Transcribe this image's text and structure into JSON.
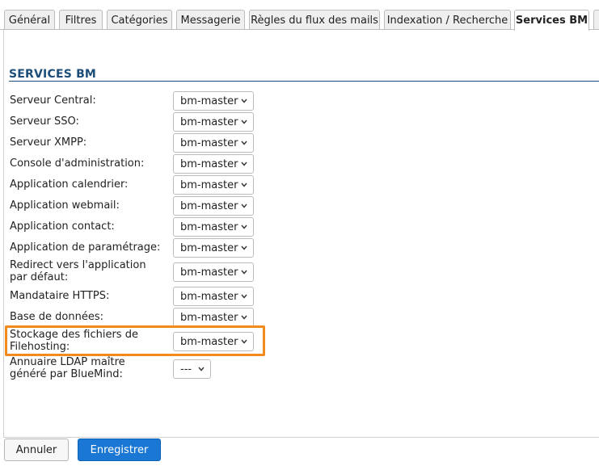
{
  "tabs": [
    {
      "label": "Général",
      "active": false
    },
    {
      "label": "Filtres",
      "active": false
    },
    {
      "label": "Catégories",
      "active": false
    },
    {
      "label": "Messagerie",
      "active": false
    },
    {
      "label": "Règles du flux des mails",
      "active": false
    },
    {
      "label": "Indexation / Recherche",
      "active": false
    },
    {
      "label": "Services BM",
      "active": true
    }
  ],
  "section": {
    "title": "SERVICES BM"
  },
  "fields": [
    {
      "label": "Serveur Central:",
      "value": "bm-master"
    },
    {
      "label": "Serveur SSO:",
      "value": "bm-master"
    },
    {
      "label": "Serveur XMPP:",
      "value": "bm-master"
    },
    {
      "label": "Console d'administration:",
      "value": "bm-master"
    },
    {
      "label": "Application calendrier:",
      "value": "bm-master"
    },
    {
      "label": "Application webmail:",
      "value": "bm-master"
    },
    {
      "label": "Application contact:",
      "value": "bm-master"
    },
    {
      "label": "Application de paramétrage:",
      "value": "bm-master"
    },
    {
      "label": "Redirect vers l'application par défaut:",
      "value": "bm-master"
    },
    {
      "label": "Mandataire HTTPS:",
      "value": "bm-master"
    },
    {
      "label": "Base de données:",
      "value": "bm-master"
    },
    {
      "label": "Stockage des fichiers de Filehosting:",
      "value": "bm-master",
      "highlighted": true
    },
    {
      "label": "Annuaire LDAP maître généré par BlueMind:",
      "value": "---"
    }
  ],
  "buttons": {
    "cancel": "Annuler",
    "save": "Enregistrer"
  },
  "colors": {
    "accent": "#1a78d4",
    "section_title": "#1c4e79",
    "highlight": "#f28a1c"
  }
}
